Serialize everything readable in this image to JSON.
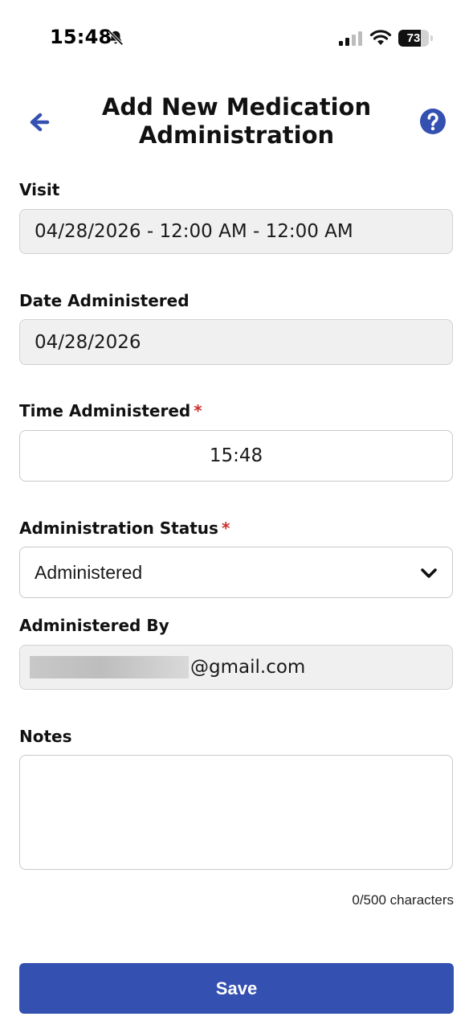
{
  "status_bar": {
    "time": "15:48",
    "battery_level": "73",
    "battery_fraction": 0.73
  },
  "icons": {
    "bell": "bell-slash-icon",
    "signal": "cellular-signal-icon",
    "wifi": "wifi-icon",
    "battery": "battery-icon",
    "back": "arrow-left-icon",
    "help": "question-circle-icon",
    "dropdown": "chevron-down-icon"
  },
  "colors": {
    "accent": "#3450b0",
    "required": "#d02e2e",
    "readonly_bg": "#f0f0f0"
  },
  "header": {
    "title_line1": "Add New Medication",
    "title_line2": "Administration"
  },
  "form": {
    "visit": {
      "label": "Visit",
      "value": "04/28/2026 - 12:00 AM - 12:00 AM"
    },
    "date_administered": {
      "label": "Date Administered",
      "value": "04/28/2026"
    },
    "time_administered": {
      "label": "Time Administered",
      "required_mark": "*",
      "value": "15:48"
    },
    "administration_status": {
      "label": "Administration Status",
      "required_mark": "*",
      "value": "Administered"
    },
    "administered_by": {
      "label": "Administered By",
      "value_suffix": "@gmail.com"
    },
    "notes": {
      "label": "Notes",
      "value": "",
      "char_count": "0/500 characters"
    }
  },
  "actions": {
    "save_label": "Save"
  }
}
